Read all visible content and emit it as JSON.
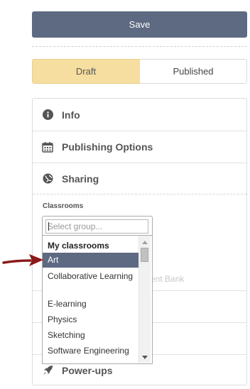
{
  "toolbar": {
    "save_label": "Save"
  },
  "status_toggle": {
    "draft_label": "Draft",
    "published_label": "Published",
    "active": "Draft"
  },
  "sections": {
    "info": {
      "label": "Info",
      "icon": "info-circle-icon"
    },
    "publishing": {
      "label": "Publishing Options",
      "icon": "calendar-icon"
    },
    "sharing": {
      "label": "Sharing",
      "icon": "globe-icon"
    },
    "powerups": {
      "label": "Power-ups",
      "icon": "rocket-icon"
    }
  },
  "classrooms": {
    "label": "Classrooms",
    "placeholder": "Select group...",
    "group_header": "My classrooms",
    "options": [
      "Art",
      "Collaborative Learning",
      "E-learning",
      "Physics",
      "Sketching",
      "Software Engineering"
    ],
    "highlighted": "Art"
  },
  "faded_text": "ssment Bank",
  "colors": {
    "primary": "#5e6a82",
    "draft": "#f5dea0",
    "pointer": "#8b1a1a"
  }
}
